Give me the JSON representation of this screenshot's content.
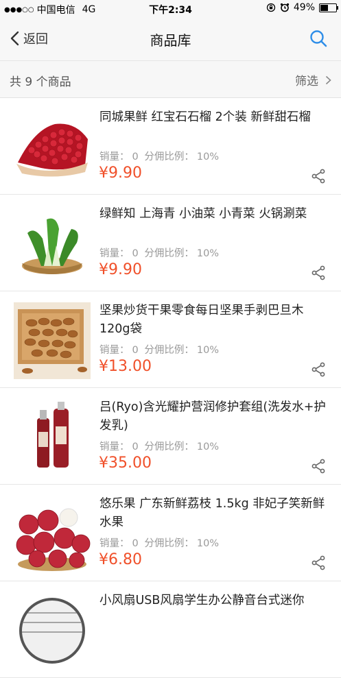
{
  "status_bar": {
    "signal": "●●●○○",
    "carrier": "中国电信",
    "network": "4G",
    "time": "下午2:34",
    "battery": "49%"
  },
  "nav": {
    "back_label": "返回",
    "title": "商品库"
  },
  "summary": {
    "count_text": "共 9 个商品",
    "filter_label": "筛选"
  },
  "products": [
    {
      "title": "同城果鲜 红宝石石榴 2个装 新鲜甜石榴",
      "sales_label": "销量：",
      "sales": "0",
      "commission_label": "分佣比例：",
      "commission": "10%",
      "price": "¥9.90",
      "image": "pomegranate"
    },
    {
      "title": "绿鲜知 上海青 小油菜 小青菜 火锅涮菜",
      "sales_label": "销量：",
      "sales": "0",
      "commission_label": "分佣比例：",
      "commission": "10%",
      "price": "¥9.90",
      "image": "bok-choy"
    },
    {
      "title": "坚果炒货干果零食每日坚果手剥巴旦木120g袋",
      "sales_label": "销量：",
      "sales": "0",
      "commission_label": "分佣比例：",
      "commission": "10%",
      "price": "¥13.00",
      "image": "almonds"
    },
    {
      "title": "吕(Ryo)含光耀护营润修护套组(洗发水+护发乳)",
      "sales_label": "销量：",
      "sales": "0",
      "commission_label": "分佣比例：",
      "commission": "10%",
      "price": "¥35.00",
      "image": "shampoo-set"
    },
    {
      "title": "悠乐果 广东新鲜荔枝 1.5kg 非妃子笑新鲜水果",
      "sales_label": "销量：",
      "sales": "0",
      "commission_label": "分佣比例：",
      "commission": "10%",
      "price": "¥6.80",
      "image": "lychee"
    },
    {
      "title": "小风扇USB风扇学生办公静音台式迷你",
      "image": "usb-fan"
    }
  ],
  "colors": {
    "price": "#f0502a",
    "accent": "#2f8ee8",
    "bar_bg": "#f7f7f7"
  }
}
